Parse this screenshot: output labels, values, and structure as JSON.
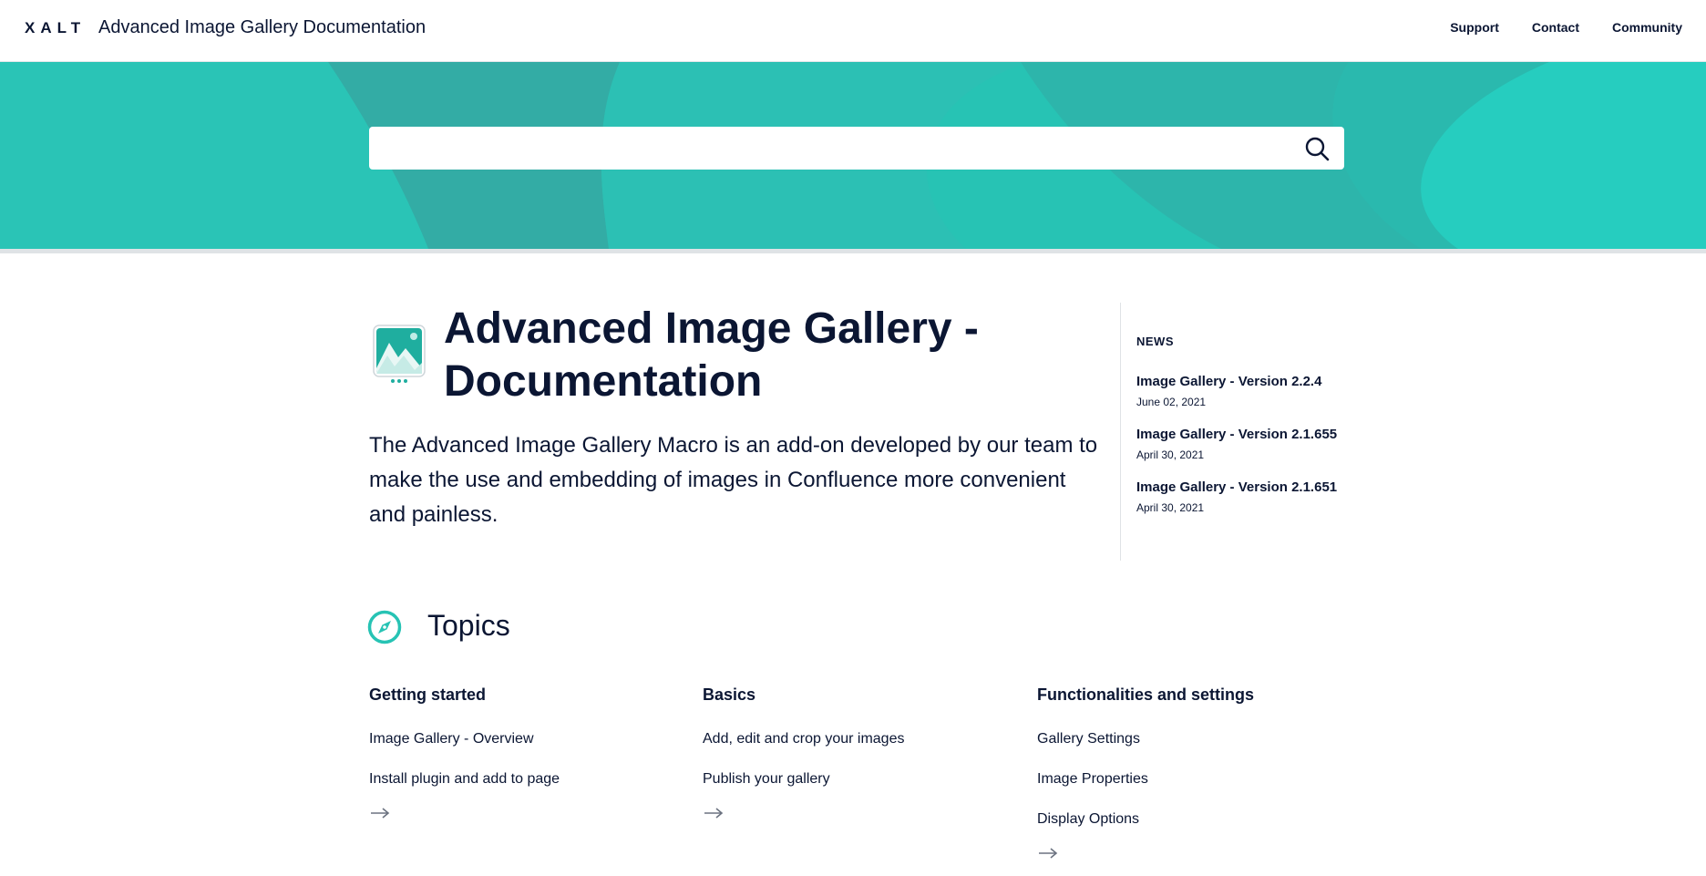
{
  "header": {
    "logo": "XALT",
    "title": "Advanced Image Gallery Documentation",
    "nav": [
      "Support",
      "Contact",
      "Community"
    ]
  },
  "search": {
    "placeholder": ""
  },
  "main": {
    "title": "Advanced Image Gallery - Documentation",
    "intro": "The Advanced Image Gallery Macro is an add-on developed by our team to make the use and embedding of images in Confluence more convenient and painless."
  },
  "news": {
    "heading": "NEWS",
    "items": [
      {
        "title": "Image Gallery - Version 2.2.4",
        "date": "June 02, 2021"
      },
      {
        "title": "Image Gallery - Version 2.1.655",
        "date": "April 30, 2021"
      },
      {
        "title": "Image Gallery - Version 2.1.651",
        "date": "April 30, 2021"
      }
    ]
  },
  "topics": {
    "title": "Topics",
    "columns": [
      {
        "heading": "Getting started",
        "links": [
          "Image Gallery - Overview",
          "Install plugin and add to page"
        ]
      },
      {
        "heading": "Basics",
        "links": [
          "Add, edit and crop your images",
          "Publish your gallery"
        ]
      },
      {
        "heading": "Functionalities and settings",
        "links": [
          "Gallery Settings",
          "Image Properties",
          "Display Options"
        ]
      }
    ]
  },
  "colors": {
    "accent": "#27c3b4",
    "text": "#0b1633",
    "divider": "#dfe3e6"
  },
  "icons": {
    "search": "search-icon",
    "app": "image-gallery-app-icon",
    "topics": "compass-icon",
    "more": "arrow-right-icon"
  }
}
